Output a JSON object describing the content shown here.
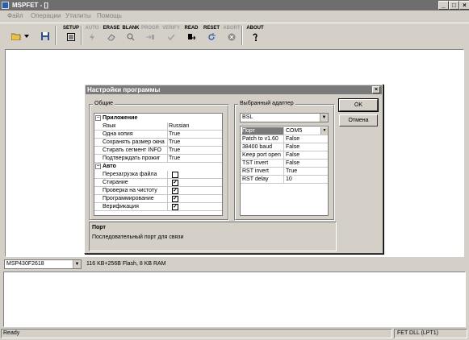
{
  "window": {
    "title": "MSPFET - []",
    "minimize": "_",
    "maximize": "□",
    "close": "×"
  },
  "menu": [
    "Файл",
    "Операции",
    "Утилиты",
    "Помощь"
  ],
  "toolbar": {
    "setup": "SETUP",
    "auto": "AUTO",
    "erase": "ERASE",
    "blank": "BLANK",
    "progr": "PROGR",
    "verify": "VERIFY",
    "read": "READ",
    "reset": "RESET",
    "abort": "ABORT",
    "about": "ABOUT"
  },
  "device": {
    "selected": "MSP430F2618",
    "info": "116 KB+256B Flash, 8 KB RAM"
  },
  "status": {
    "left": "Ready",
    "right": "FET DLL (LPT1)"
  },
  "dialog": {
    "title": "Настройки программы",
    "close": "×",
    "general_label": "Общие",
    "adapter_label": "Выбранный адаптер",
    "categories": {
      "app": "Приложение",
      "auto": "Авто"
    },
    "app_props": [
      {
        "name": "Язык",
        "value": "Russian"
      },
      {
        "name": "Одна копия",
        "value": "True"
      },
      {
        "name": "Сохранять размер окна",
        "value": "True"
      },
      {
        "name": "Стирать сегмент INFO",
        "value": "True"
      },
      {
        "name": "Подтверждать прожиг",
        "value": "True"
      }
    ],
    "auto_props": [
      {
        "name": "Перезагрузка файла",
        "checked": false
      },
      {
        "name": "Стирание",
        "checked": true
      },
      {
        "name": "Проверка на чистоту",
        "checked": true
      },
      {
        "name": "Программирование",
        "checked": true
      },
      {
        "name": "Верификация",
        "checked": true
      }
    ],
    "adapter_selected": "BSL",
    "adapter_props": [
      {
        "name": "Порт",
        "value": "COM5"
      },
      {
        "name": "Patch to v1.60",
        "value": "False"
      },
      {
        "name": "38400 baud",
        "value": "False"
      },
      {
        "name": "Keep port open",
        "value": "False"
      },
      {
        "name": "TST invert",
        "value": "False"
      },
      {
        "name": "RST invert",
        "value": "True"
      },
      {
        "name": "RST delay",
        "value": "10"
      }
    ],
    "desc_title": "Порт",
    "desc_text": "Последовательный порт для связи",
    "ok": "OK",
    "cancel": "Отмена",
    "check_mark": "✓",
    "expand_mark": "−"
  }
}
